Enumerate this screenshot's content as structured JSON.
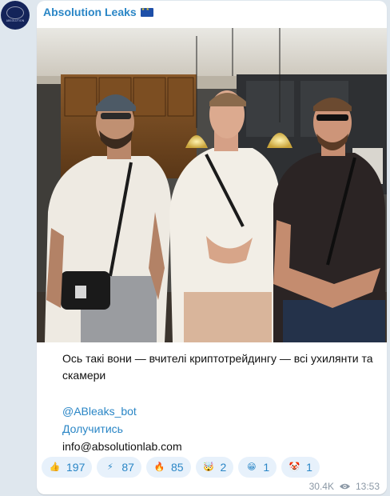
{
  "channel": {
    "name": "Absolution Leaks",
    "flag_icon": "eu-flag-icon",
    "avatar_text": "ABSOLUTION"
  },
  "post": {
    "photo_description_icon": "photo-three-men",
    "caption": "Ось такі вони — вчителі криптотрейдингу — всі ухилянти та скамери",
    "bot_link": "@ABleaks_bot",
    "join_link": "Долучитись",
    "email": "info@absolutionlab.com"
  },
  "reactions": [
    {
      "icon": "thumbs-up-icon",
      "emoji": "👍",
      "count": "197",
      "color": "#f2b52a"
    },
    {
      "icon": "lightning-icon",
      "emoji": "⚡",
      "count": "87",
      "color": "#f5c518"
    },
    {
      "icon": "fire-icon",
      "emoji": "🔥",
      "count": "85",
      "color": "#f06a1d"
    },
    {
      "icon": "mind-blown-icon",
      "emoji": "🤯",
      "count": "2",
      "color": "#f2b52a"
    },
    {
      "icon": "grin-icon",
      "emoji": "😁",
      "count": "1",
      "color": "#f2b52a"
    },
    {
      "icon": "clown-icon",
      "emoji": "🤡",
      "count": "1",
      "color": "#e8484a"
    }
  ],
  "meta": {
    "views": "30.4K",
    "time": "13:53"
  },
  "colors": {
    "accent": "#2a86c6",
    "reaction_bg": "#e7f1fb",
    "chat_bg": "#dfe7ee"
  }
}
